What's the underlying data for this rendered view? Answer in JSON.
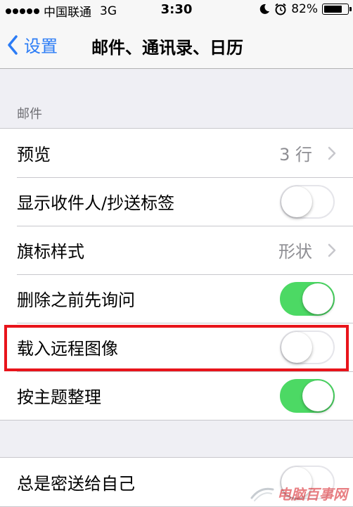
{
  "status_bar": {
    "carrier": "中国联通",
    "network": "3G",
    "time": "3:30",
    "battery": "82%",
    "battery_level": 0.82
  },
  "nav": {
    "back_label": "设置",
    "title": "邮件、通讯录、日历"
  },
  "sections": [
    {
      "header": "邮件",
      "rows": [
        {
          "label": "预览",
          "value": "3 行",
          "type": "disclosure"
        },
        {
          "label": "显示收件人/抄送标签",
          "type": "toggle",
          "on": false
        },
        {
          "label": "旗标样式",
          "value": "形状",
          "type": "disclosure"
        },
        {
          "label": "删除之前先询问",
          "type": "toggle",
          "on": true
        },
        {
          "label": "载入远程图像",
          "type": "toggle",
          "on": false
        },
        {
          "label": "按主题整理",
          "type": "toggle",
          "on": true
        }
      ]
    },
    {
      "rows": [
        {
          "label": "总是密送给自己",
          "type": "toggle",
          "on": false
        }
      ]
    }
  ],
  "colors": {
    "accent": "#2b7cf6",
    "toggle_on": "#4cd964",
    "highlight": "#e8141b",
    "background": "#efeff4"
  },
  "watermark": {
    "text": "电脑百事网"
  }
}
